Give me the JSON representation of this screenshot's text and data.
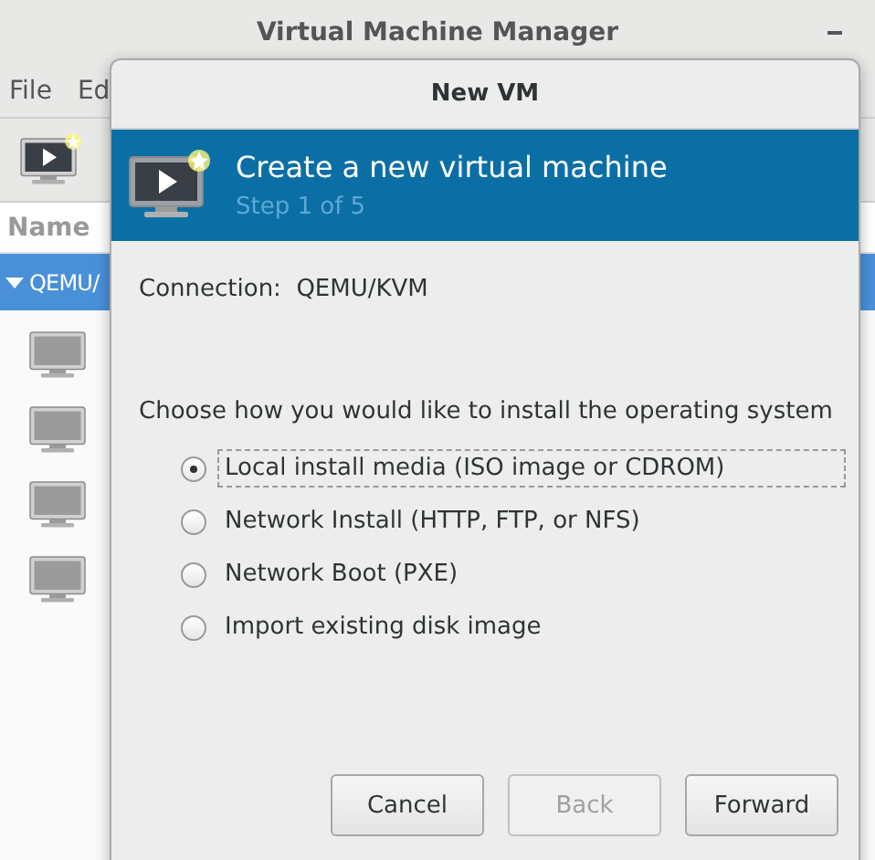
{
  "main_window": {
    "title": "Virtual Machine Manager",
    "menu": [
      "File",
      "Ed"
    ],
    "list_header": "Name",
    "connection_row": {
      "label": "QEMU/",
      "expanded": true,
      "selected": true
    }
  },
  "dialog": {
    "title": "New VM",
    "header": {
      "title": "Create a new virtual machine",
      "step": "Step 1 of 5"
    },
    "connection": {
      "label": "Connection:",
      "value": "QEMU/KVM"
    },
    "prompt": "Choose how you would like to install the operating system",
    "options": [
      {
        "label": "Local install media (ISO image or CDROM)",
        "selected": true
      },
      {
        "label": "Network Install (HTTP, FTP, or NFS)",
        "selected": false
      },
      {
        "label": "Network Boot (PXE)",
        "selected": false
      },
      {
        "label": "Import existing disk image",
        "selected": false
      }
    ],
    "buttons": [
      {
        "label": "Cancel",
        "disabled": false
      },
      {
        "label": "Back",
        "disabled": true
      },
      {
        "label": "Forward",
        "disabled": false
      }
    ]
  }
}
